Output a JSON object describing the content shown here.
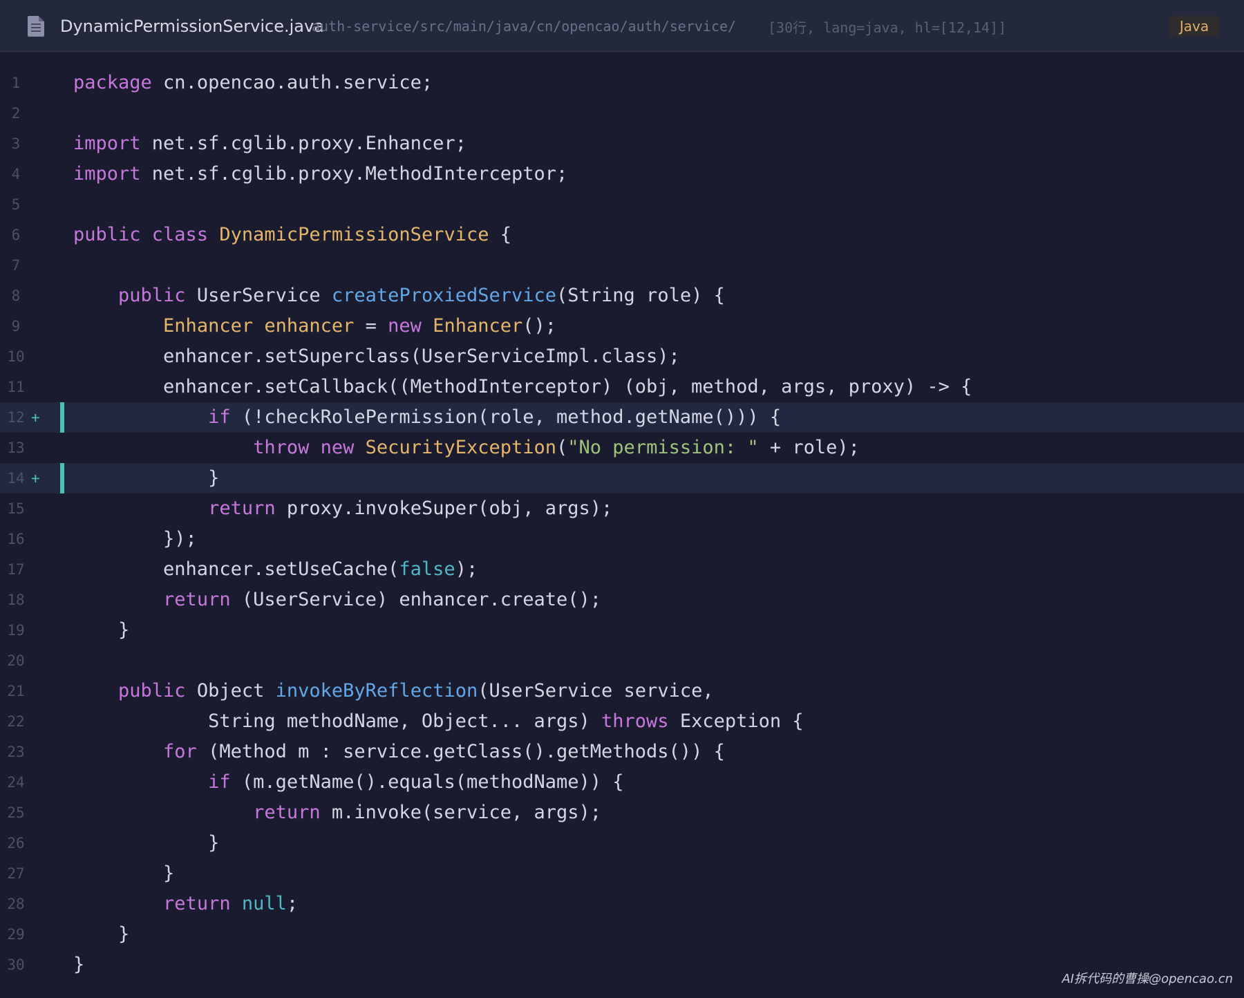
{
  "header": {
    "file_icon": "document-icon",
    "file_name": "DynamicPermissionService.java",
    "path": "auth-service/src/main/java/cn/opencao/auth/service/",
    "meta": "[30行, lang=java, hl=[12,14]]",
    "language": "Java"
  },
  "colors": {
    "background": "#1a1b2e",
    "header_background": "#24283b",
    "keyword": "#c678dd",
    "type": "#e5b56a",
    "function": "#61a8e8",
    "string": "#9ec37a",
    "literal": "#4fb8c4",
    "highlight_bar": "#4fc1b4"
  },
  "code": {
    "lines": [
      {
        "n": "1",
        "marker": "",
        "tokens": [
          [
            "kw",
            "package"
          ],
          [
            "pl",
            " cn.opencao.auth.service;"
          ]
        ]
      },
      {
        "n": "2",
        "marker": "",
        "tokens": []
      },
      {
        "n": "3",
        "marker": "",
        "tokens": [
          [
            "kw",
            "import"
          ],
          [
            "pl",
            " net.sf.cglib.proxy.Enhancer;"
          ]
        ]
      },
      {
        "n": "4",
        "marker": "",
        "tokens": [
          [
            "kw",
            "import"
          ],
          [
            "pl",
            " net.sf.cglib.proxy.MethodInterceptor;"
          ]
        ]
      },
      {
        "n": "5",
        "marker": "",
        "tokens": []
      },
      {
        "n": "6",
        "marker": "",
        "tokens": [
          [
            "kw",
            "public class"
          ],
          [
            "pl",
            " "
          ],
          [
            "ty",
            "DynamicPermissionService"
          ],
          [
            "pl",
            " {"
          ]
        ]
      },
      {
        "n": "7",
        "marker": "",
        "tokens": []
      },
      {
        "n": "8",
        "marker": "",
        "tokens": [
          [
            "pl",
            "    "
          ],
          [
            "kw",
            "public"
          ],
          [
            "pl",
            " UserService "
          ],
          [
            "fn",
            "createProxiedService"
          ],
          [
            "pl",
            "(String role) {"
          ]
        ]
      },
      {
        "n": "9",
        "marker": "",
        "tokens": [
          [
            "pl",
            "        "
          ],
          [
            "ty",
            "Enhancer enhancer"
          ],
          [
            "pl",
            " = "
          ],
          [
            "kw",
            "new"
          ],
          [
            "pl",
            " "
          ],
          [
            "ty",
            "Enhancer"
          ],
          [
            "pl",
            "();"
          ]
        ]
      },
      {
        "n": "10",
        "marker": "",
        "tokens": [
          [
            "pl",
            "        enhancer.setSuperclass(UserServiceImpl.class);"
          ]
        ]
      },
      {
        "n": "11",
        "marker": "",
        "tokens": [
          [
            "pl",
            "        enhancer.setCallback((MethodInterceptor) (obj, method, args, proxy) -> {"
          ]
        ]
      },
      {
        "n": "12",
        "marker": "+",
        "tokens": [
          [
            "pl",
            "            "
          ],
          [
            "kw",
            "if"
          ],
          [
            "pl",
            " (!checkRolePermission(role, method.getName())) {"
          ]
        ]
      },
      {
        "n": "13",
        "marker": "",
        "tokens": [
          [
            "pl",
            "                "
          ],
          [
            "kw",
            "throw new"
          ],
          [
            "pl",
            " "
          ],
          [
            "ty",
            "SecurityException"
          ],
          [
            "pl",
            "("
          ],
          [
            "st",
            "\"No permission: \""
          ],
          [
            "pl",
            " + role);"
          ]
        ]
      },
      {
        "n": "14",
        "marker": "+",
        "tokens": [
          [
            "pl",
            "            }"
          ]
        ]
      },
      {
        "n": "15",
        "marker": "",
        "tokens": [
          [
            "pl",
            "            "
          ],
          [
            "kw",
            "return"
          ],
          [
            "pl",
            " proxy.invokeSuper(obj, args);"
          ]
        ]
      },
      {
        "n": "16",
        "marker": "",
        "tokens": [
          [
            "pl",
            "        });"
          ]
        ]
      },
      {
        "n": "17",
        "marker": "",
        "tokens": [
          [
            "pl",
            "        enhancer.setUseCache("
          ],
          [
            "lt",
            "false"
          ],
          [
            "pl",
            ");"
          ]
        ]
      },
      {
        "n": "18",
        "marker": "",
        "tokens": [
          [
            "pl",
            "        "
          ],
          [
            "kw",
            "return"
          ],
          [
            "pl",
            " (UserService) enhancer.create();"
          ]
        ]
      },
      {
        "n": "19",
        "marker": "",
        "tokens": [
          [
            "pl",
            "    }"
          ]
        ]
      },
      {
        "n": "20",
        "marker": "",
        "tokens": []
      },
      {
        "n": "21",
        "marker": "",
        "tokens": [
          [
            "pl",
            "    "
          ],
          [
            "kw",
            "public"
          ],
          [
            "pl",
            " Object "
          ],
          [
            "fn",
            "invokeByReflection"
          ],
          [
            "pl",
            "(UserService service,"
          ]
        ]
      },
      {
        "n": "22",
        "marker": "",
        "tokens": [
          [
            "pl",
            "            String methodName, Object... args) "
          ],
          [
            "kw",
            "throws"
          ],
          [
            "pl",
            " Exception {"
          ]
        ]
      },
      {
        "n": "23",
        "marker": "",
        "tokens": [
          [
            "pl",
            "        "
          ],
          [
            "kw",
            "for"
          ],
          [
            "pl",
            " (Method m : service.getClass().getMethods()) {"
          ]
        ]
      },
      {
        "n": "24",
        "marker": "",
        "tokens": [
          [
            "pl",
            "            "
          ],
          [
            "kw",
            "if"
          ],
          [
            "pl",
            " (m.getName().equals(methodName)) {"
          ]
        ]
      },
      {
        "n": "25",
        "marker": "",
        "tokens": [
          [
            "pl",
            "                "
          ],
          [
            "kw",
            "return"
          ],
          [
            "pl",
            " m.invoke(service, args);"
          ]
        ]
      },
      {
        "n": "26",
        "marker": "",
        "tokens": [
          [
            "pl",
            "            }"
          ]
        ]
      },
      {
        "n": "27",
        "marker": "",
        "tokens": [
          [
            "pl",
            "        }"
          ]
        ]
      },
      {
        "n": "28",
        "marker": "",
        "tokens": [
          [
            "pl",
            "        "
          ],
          [
            "kw",
            "return"
          ],
          [
            "pl",
            " "
          ],
          [
            "lt",
            "null"
          ],
          [
            "pl",
            ";"
          ]
        ]
      },
      {
        "n": "29",
        "marker": "",
        "tokens": [
          [
            "pl",
            "    }"
          ]
        ]
      },
      {
        "n": "30",
        "marker": "",
        "tokens": [
          [
            "pl",
            "}"
          ]
        ]
      }
    ],
    "highlighted_lines": [
      "12",
      "14"
    ]
  },
  "watermark": "AI拆代码的曹操@opencao.cn"
}
